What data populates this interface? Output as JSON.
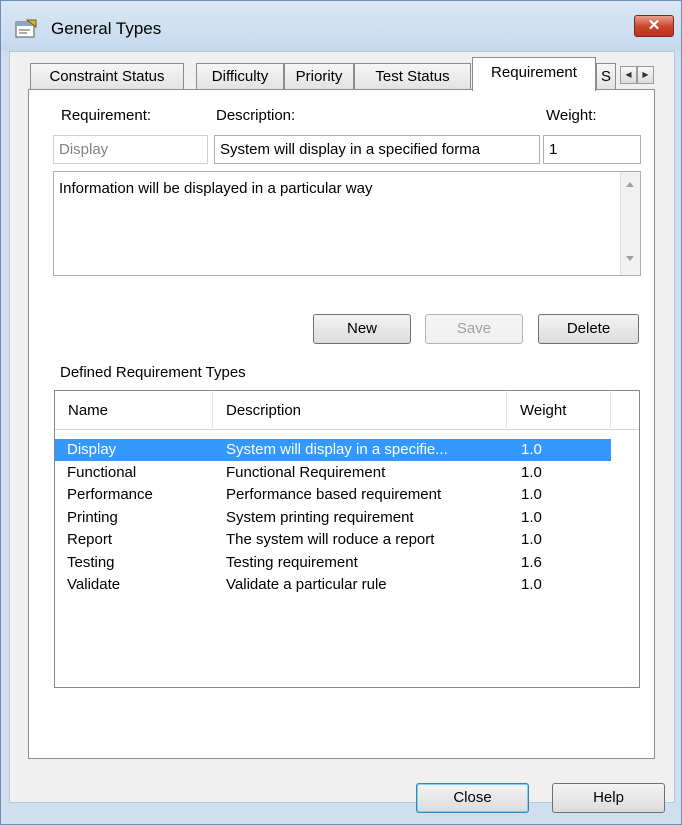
{
  "window": {
    "title": "General Types",
    "close_glyph": "✕",
    "icon": "properties-icon"
  },
  "tabs": [
    {
      "label": "Constraint Status"
    },
    {
      "label": "Difficulty"
    },
    {
      "label": "Priority"
    },
    {
      "label": "Test Status"
    },
    {
      "label": "Requirement"
    },
    {
      "label": "S"
    }
  ],
  "tab_scroll": {
    "left": "◀",
    "right": "▶"
  },
  "form": {
    "requirement_label": "Requirement:",
    "description_label": "Description:",
    "weight_label": "Weight:",
    "requirement_value": "Display",
    "description_value": "System will display in a specified forma",
    "weight_value": "1",
    "notes_value": "Information will be displayed in a particular way"
  },
  "buttons": {
    "new": "New",
    "save": "Save",
    "delete": "Delete",
    "close": "Close",
    "help": "Help"
  },
  "list": {
    "label": "Defined Requirement Types",
    "columns": [
      "Name",
      "Description",
      "Weight"
    ],
    "rows": [
      {
        "name": "Display",
        "description": "System will display in a specifie...",
        "weight": "1.0",
        "selected": true
      },
      {
        "name": "Functional",
        "description": "Functional Requirement",
        "weight": "1.0"
      },
      {
        "name": "Performance",
        "description": "Performance based requirement",
        "weight": "1.0"
      },
      {
        "name": "Printing",
        "description": "System printing requirement",
        "weight": "1.0"
      },
      {
        "name": "Report",
        "description": "The system will roduce a report",
        "weight": "1.0"
      },
      {
        "name": "Testing",
        "description": "Testing requirement",
        "weight": "1.6"
      },
      {
        "name": "Validate",
        "description": "Validate a particular rule",
        "weight": "1.0"
      }
    ]
  },
  "colors": {
    "selection": "#3399ff",
    "frame": "#cfdfee",
    "close_red": "#c9442b"
  }
}
